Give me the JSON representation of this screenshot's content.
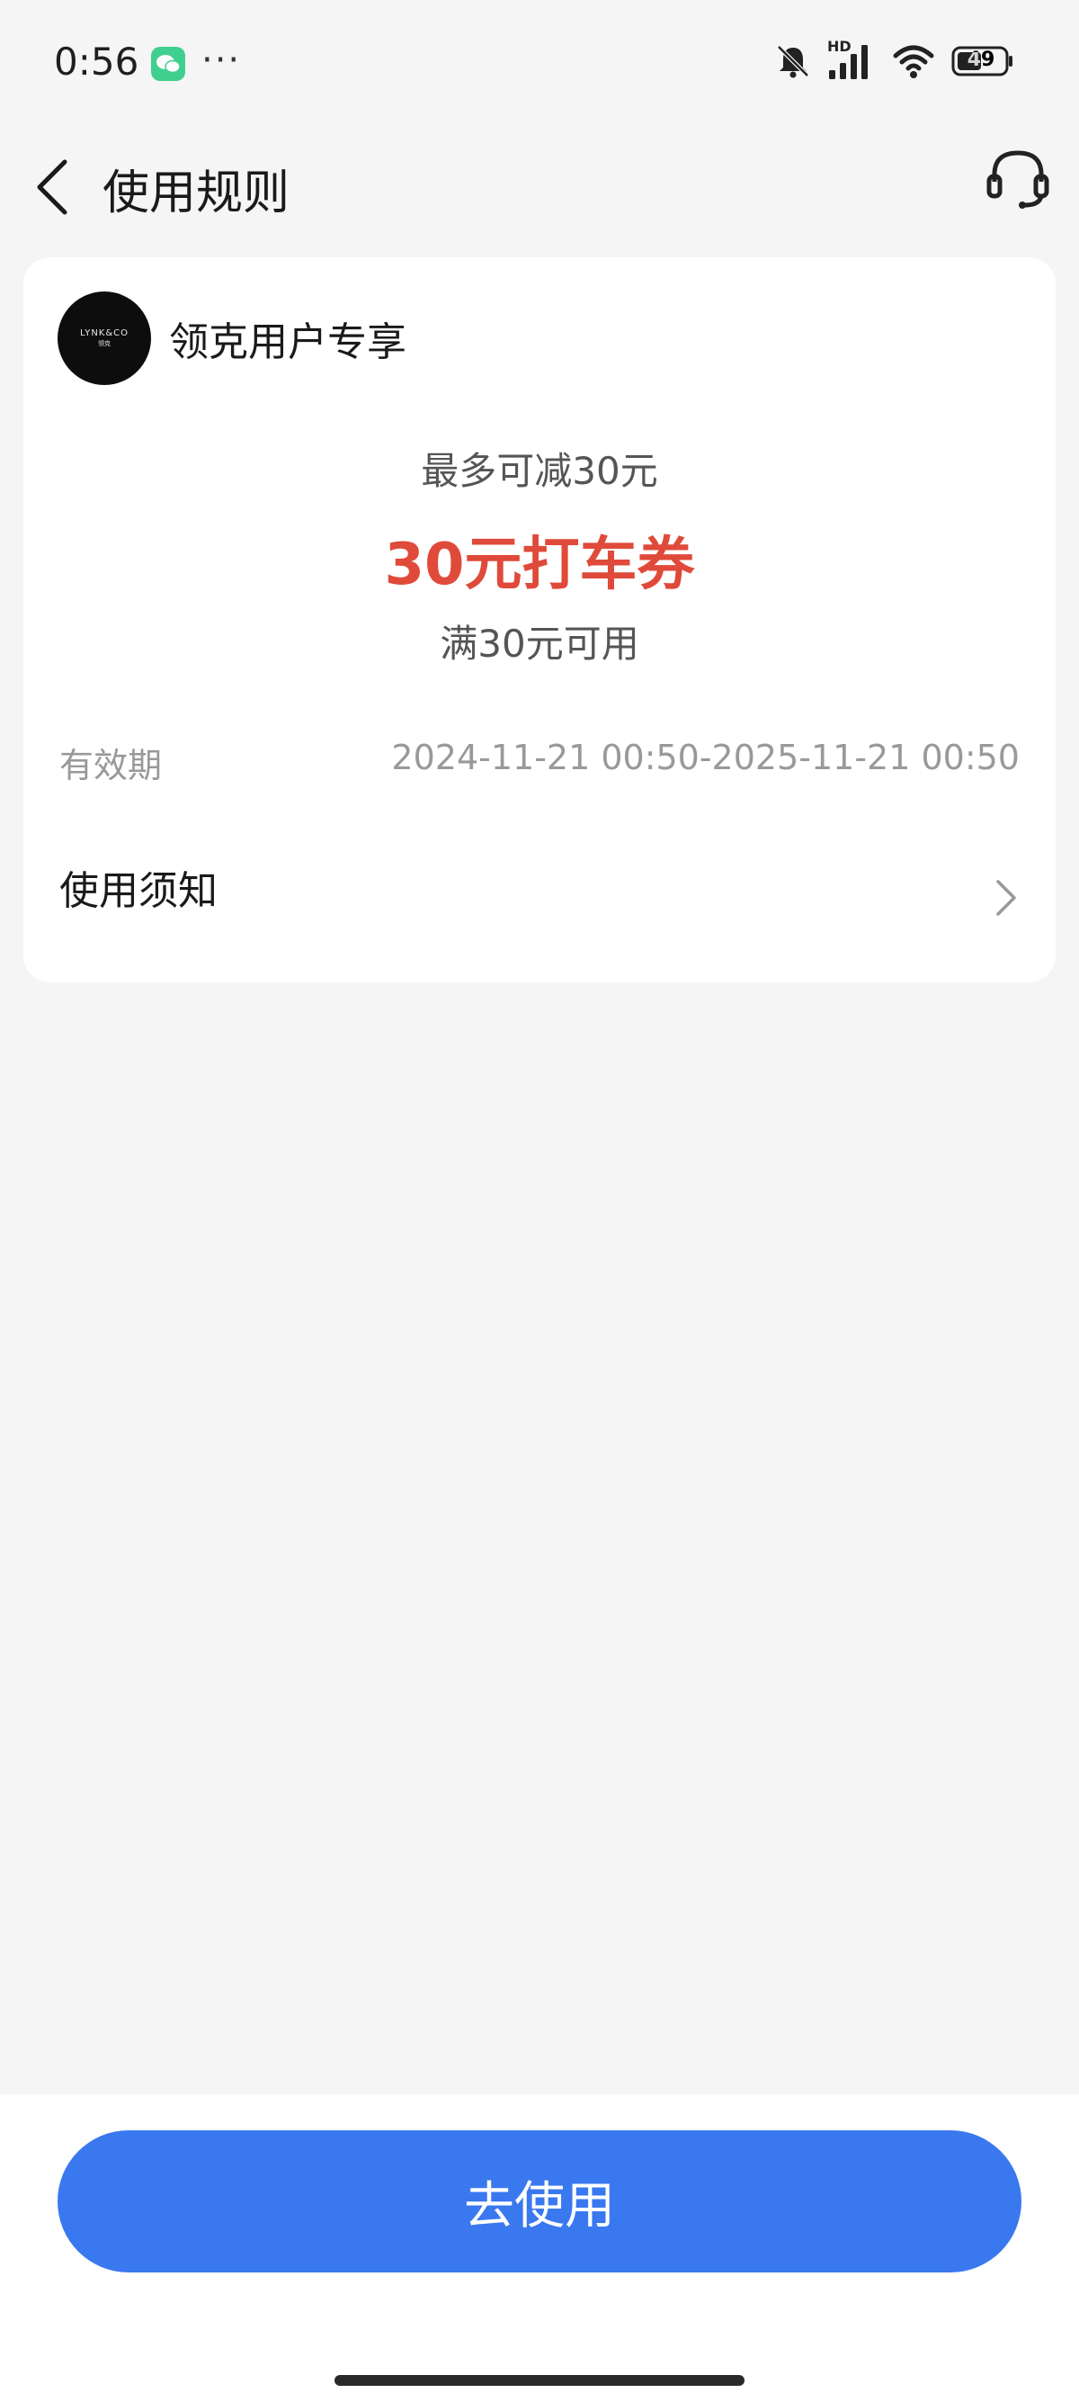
{
  "status_bar": {
    "time": "0:56",
    "more": "···",
    "battery": "49",
    "network": "HD",
    "icons": [
      "wechat-icon",
      "mute-bell-icon",
      "signal-icon",
      "wifi-icon",
      "battery-icon"
    ]
  },
  "header": {
    "title": "使用规则",
    "icons": [
      "back-icon",
      "customer-service-icon"
    ]
  },
  "card": {
    "brand_logo_text": "LYNK&CO",
    "brand_logo_sub": "领克",
    "brand_name": "领克用户专享",
    "max_reduce": "最多可减30元",
    "coupon_title": "30元打车券",
    "condition": "满30元可用",
    "validity_label": "有效期",
    "validity_value": "2024-11-21 00:50-2025-11-21 00:50",
    "notice_label": "使用须知"
  },
  "bottom": {
    "use_button": "去使用"
  },
  "colors": {
    "accent_blue": "#3a78f0",
    "coupon_red": "#e04a3a",
    "background": "#f5f5f5"
  }
}
